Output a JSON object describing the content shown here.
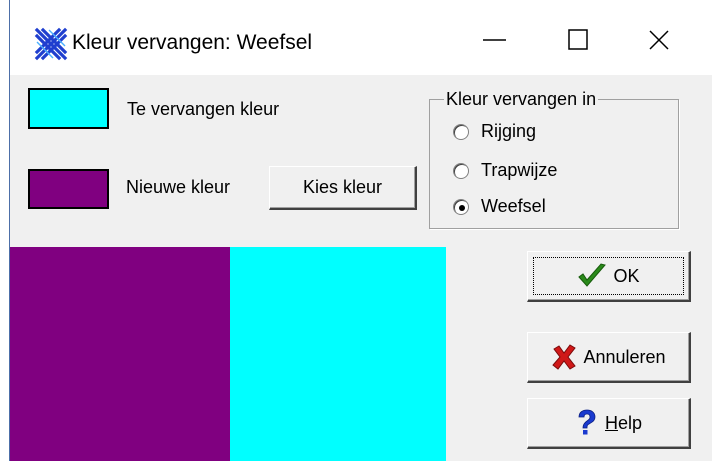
{
  "window": {
    "title": "Kleur vervangen: Weefsel",
    "icon": "app-weave-icon"
  },
  "titlebar_buttons": [
    "minimize-icon",
    "maximize-icon",
    "close-icon"
  ],
  "colors": {
    "replace_color": "#00ffff",
    "new_color": "#800080"
  },
  "labels": {
    "replace_color": "Te vervangen kleur",
    "new_color": "Nieuwe kleur"
  },
  "pick_color_button": "Kies kleur",
  "replace_in": {
    "title": "Kleur vervangen in",
    "options": [
      {
        "label": "Rijging",
        "selected": false
      },
      {
        "label": "Trapwijze",
        "selected": false
      },
      {
        "label": "Weefsel",
        "selected": true
      }
    ]
  },
  "buttons": {
    "ok": {
      "label": "OK",
      "icon": "checkmark-icon"
    },
    "cancel": {
      "label": "Annuleren",
      "icon": "red-x-icon"
    },
    "help": {
      "label": "Help",
      "mnemonic": "H",
      "rest": "elp",
      "icon": "question-mark-icon"
    }
  }
}
